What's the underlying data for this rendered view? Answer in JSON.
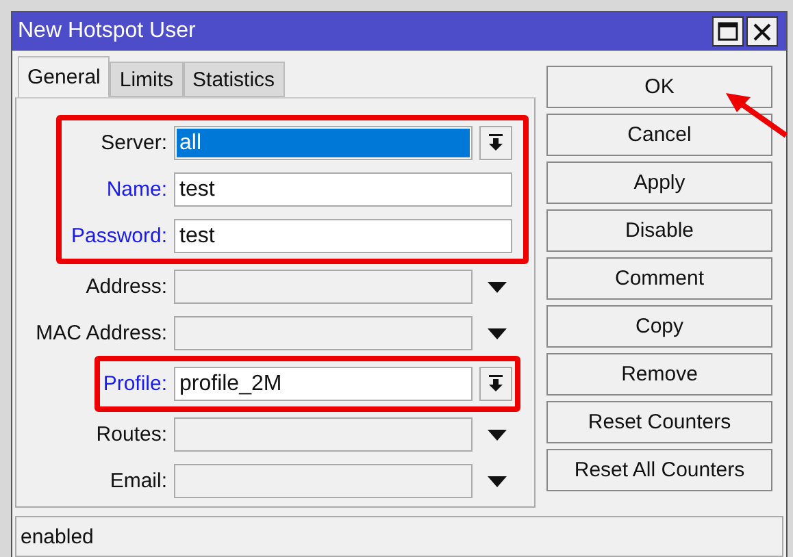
{
  "window": {
    "title": "New Hotspot User"
  },
  "tabs": [
    {
      "label": "General",
      "selected": true
    },
    {
      "label": "Limits",
      "selected": false
    },
    {
      "label": "Statistics",
      "selected": false
    }
  ],
  "fields": [
    {
      "label": "Server:",
      "kind": "select",
      "value": "all",
      "value_selected": true,
      "required": false,
      "highlighted": true
    },
    {
      "label": "Name:",
      "kind": "text",
      "value": "test",
      "required": true,
      "highlighted": true
    },
    {
      "label": "Password:",
      "kind": "text",
      "value": "test",
      "required": true,
      "highlighted": true
    },
    {
      "label": "Address:",
      "kind": "combo",
      "required": false,
      "highlighted": false
    },
    {
      "label": "MAC Address:",
      "kind": "combo",
      "required": false,
      "highlighted": false
    },
    {
      "label": "Profile:",
      "kind": "select",
      "value": "profile_2M",
      "value_selected": false,
      "required": true,
      "highlighted": true
    },
    {
      "label": "Routes:",
      "kind": "combo",
      "required": false,
      "highlighted": false
    },
    {
      "label": "Email:",
      "kind": "combo",
      "required": false,
      "highlighted": false
    }
  ],
  "buttons": [
    {
      "label": "OK",
      "pointed": true
    },
    {
      "label": "Cancel",
      "pointed": false
    },
    {
      "label": "Apply",
      "pointed": false
    },
    {
      "label": "Disable",
      "pointed": false
    },
    {
      "label": "Comment",
      "pointed": false
    },
    {
      "label": "Copy",
      "pointed": false
    },
    {
      "label": "Remove",
      "pointed": false
    },
    {
      "label": "Reset Counters",
      "pointed": false
    },
    {
      "label": "Reset All Counters",
      "pointed": false
    }
  ],
  "status_bar": {
    "text": "enabled"
  }
}
